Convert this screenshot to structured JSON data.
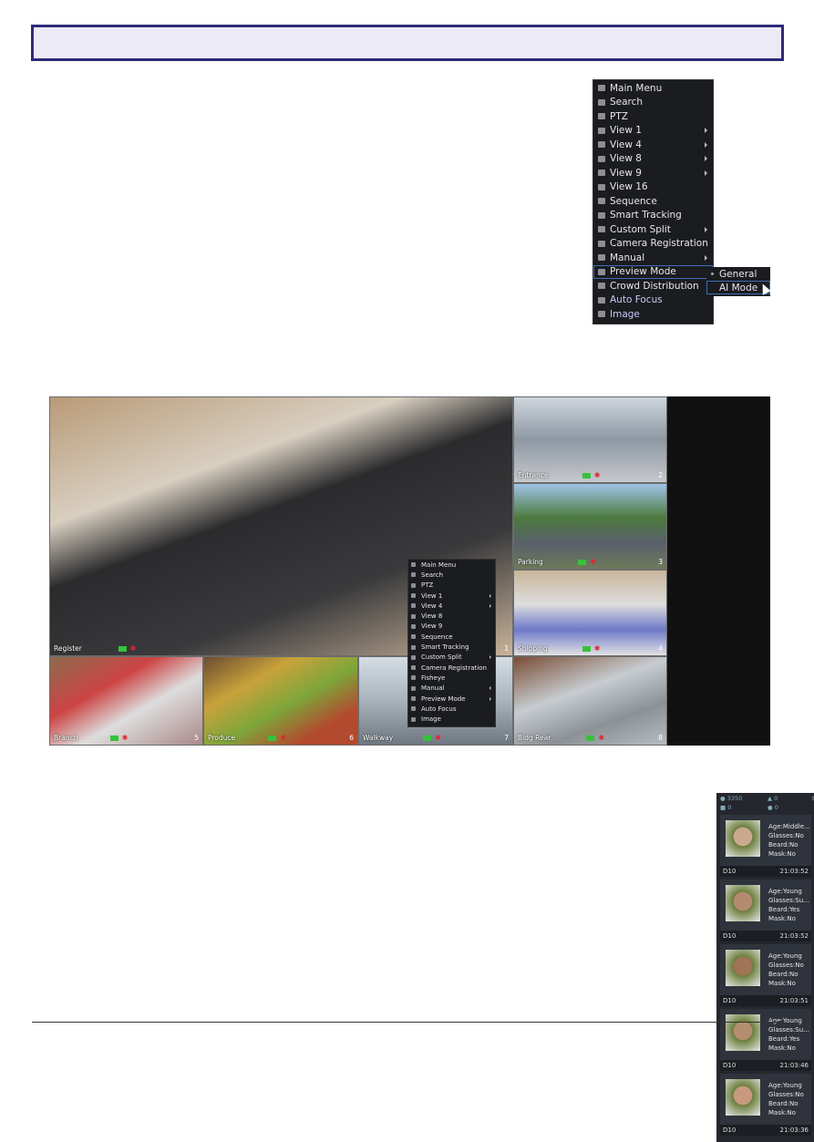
{
  "context_menu": {
    "items": [
      {
        "label": "Main Menu",
        "icon": "home-icon",
        "submenu": false
      },
      {
        "label": "Search",
        "icon": "search-icon",
        "submenu": false
      },
      {
        "label": "PTZ",
        "icon": "ptz-camera-icon",
        "submenu": false
      },
      {
        "label": "View 1",
        "icon": "view-1-icon",
        "submenu": true
      },
      {
        "label": "View 4",
        "icon": "view-4-icon",
        "submenu": true
      },
      {
        "label": "View 8",
        "icon": "view-8-icon",
        "submenu": true
      },
      {
        "label": "View 9",
        "icon": "view-9-icon",
        "submenu": true
      },
      {
        "label": "View 16",
        "icon": "view-16-icon",
        "submenu": false
      },
      {
        "label": "Sequence",
        "icon": "sequence-icon",
        "submenu": false
      },
      {
        "label": "Smart Tracking",
        "icon": "tracking-icon",
        "submenu": false
      },
      {
        "label": "Custom Split",
        "icon": "split-icon",
        "submenu": true
      },
      {
        "label": "Camera Registration",
        "icon": "camera-registration-icon",
        "submenu": false
      },
      {
        "label": "Manual",
        "icon": "manual-icon",
        "submenu": true
      },
      {
        "label": "Preview Mode",
        "icon": "monitor-icon",
        "submenu": false,
        "selected": true
      },
      {
        "label": "Crowd Distribution",
        "icon": "crowd-icon",
        "submenu": false
      },
      {
        "label": "Auto Focus",
        "icon": "focus-icon",
        "submenu": false
      },
      {
        "label": "Image",
        "icon": "image-icon",
        "submenu": false
      }
    ],
    "preview_submenu": [
      {
        "label": "General",
        "active": true
      },
      {
        "label": "AI Mode",
        "selected": true
      }
    ]
  },
  "live_view": {
    "tiles": [
      {
        "name": "Register",
        "number": "1"
      },
      {
        "name": "Entrance",
        "number": "2"
      },
      {
        "name": "Parking",
        "number": "3"
      },
      {
        "name": "Shipping",
        "number": "4"
      },
      {
        "name": "Branch",
        "number": "5"
      },
      {
        "name": "Produce",
        "number": "6"
      },
      {
        "name": "Walkway",
        "number": "7"
      },
      {
        "name": "Bldg Rear",
        "number": "8"
      }
    ],
    "context_menu_items": [
      {
        "label": "Main Menu",
        "submenu": false
      },
      {
        "label": "Search",
        "submenu": false
      },
      {
        "label": "PTZ",
        "submenu": false
      },
      {
        "label": "View 1",
        "submenu": true
      },
      {
        "label": "View 4",
        "submenu": true
      },
      {
        "label": "View 8",
        "submenu": false
      },
      {
        "label": "View 9",
        "submenu": false
      },
      {
        "label": "Sequence",
        "submenu": false
      },
      {
        "label": "Smart Tracking",
        "submenu": false
      },
      {
        "label": "Custom Split",
        "submenu": true
      },
      {
        "label": "Camera Registration",
        "submenu": false
      },
      {
        "label": "Fisheye",
        "submenu": false
      },
      {
        "label": "Manual",
        "submenu": true
      },
      {
        "label": "Preview Mode",
        "submenu": true
      },
      {
        "label": "Auto Focus",
        "submenu": false
      },
      {
        "label": "Image",
        "submenu": false
      }
    ]
  },
  "ai_panel": {
    "people_count": "3350",
    "vehicle_count": "0",
    "non_motor_count": "0",
    "other_count": "0",
    "cards": [
      {
        "age": "Age:Middle...",
        "glasses": "Glasses:No",
        "beard": "Beard:No",
        "mask": "Mask:No",
        "channel": "D10",
        "time": "21:03:52"
      },
      {
        "age": "Age:Young",
        "glasses": "Glasses:Su...",
        "beard": "Beard:Yes",
        "mask": "Mask:No",
        "channel": "D10",
        "time": "21:03:52"
      },
      {
        "age": "Age:Young",
        "glasses": "Glasses:No",
        "beard": "Beard:No",
        "mask": "Mask:No",
        "channel": "D10",
        "time": "21:03:51"
      },
      {
        "age": "Age:Young",
        "glasses": "Glasses:Su...",
        "beard": "Beard:Yes",
        "mask": "Mask:No",
        "channel": "D10",
        "time": "21:03:46"
      },
      {
        "age": "Age:Young",
        "glasses": "Glasses:No",
        "beard": "Beard:No",
        "mask": "Mask:No",
        "channel": "D10",
        "time": "21:03:36"
      }
    ]
  },
  "colors": {
    "header_border": "#2e2a78",
    "menu_bg": "#1b1c20",
    "selection": "#3a6fb5",
    "record": "#36c23b",
    "motion": "#e2262d"
  }
}
